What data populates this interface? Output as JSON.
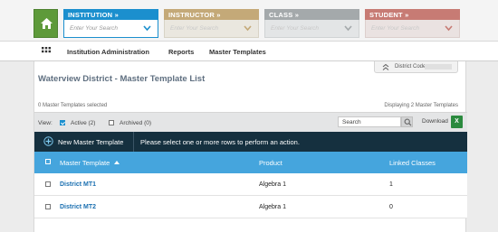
{
  "selectors": [
    {
      "key": "institution",
      "label": "INSTITUTION »",
      "placeholder": "Enter Your Search"
    },
    {
      "key": "instructor",
      "label": "INSTRUCTOR »",
      "placeholder": "Enter Your Search"
    },
    {
      "key": "class",
      "label": "CLASS »",
      "placeholder": "Enter Your Search"
    },
    {
      "key": "student",
      "label": "STUDENT »",
      "placeholder": "Enter Your Search"
    }
  ],
  "nav": {
    "items": [
      "Institution Administration",
      "Reports",
      "Master Templates"
    ]
  },
  "page": {
    "title": "Waterview District - Master Template List",
    "district_code_label": "District Code:",
    "selected_count": "0 Master Templates selected",
    "displaying": "Displaying 2 Master Templates"
  },
  "filters": {
    "view_label": "View:",
    "active_label": "Active (2)",
    "active_checked": true,
    "archived_label": "Archived (0)",
    "archived_checked": false,
    "search_placeholder": "Search",
    "download_label": "Download"
  },
  "actions": {
    "new_label": "New Master Template",
    "message": "Please select one or more rows to perform an action."
  },
  "table": {
    "columns": [
      "Master Template",
      "Product",
      "Linked Classes"
    ],
    "sort_column": "Master Template",
    "sort_direction": "asc",
    "rows": [
      {
        "name": "District MT1",
        "product": "Algebra 1",
        "linked": "1"
      },
      {
        "name": "District MT2",
        "product": "Algebra 1",
        "linked": "0"
      }
    ]
  },
  "colors": {
    "institution": "#1b8fce",
    "instructor": "#c4a978",
    "class": "#a4a9ab",
    "student": "#c77b74",
    "action_bar": "#15303f",
    "table_header": "#45a5dd",
    "home": "#5e9a3a",
    "link": "#1a6fb0"
  },
  "icons": [
    "home-icon",
    "chevron-down-icon",
    "apps-grid-icon",
    "expand-icon",
    "search-icon",
    "excel-icon",
    "plus-circle-icon",
    "sort-up-icon"
  ]
}
